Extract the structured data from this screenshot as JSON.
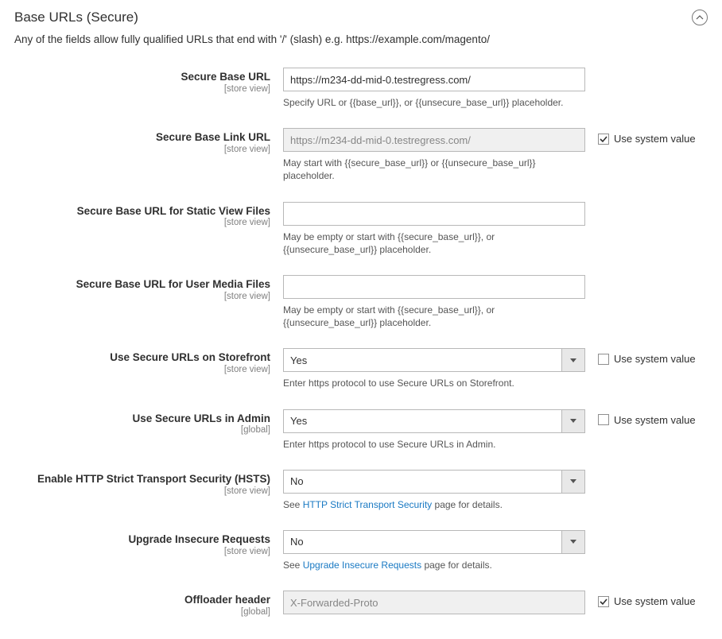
{
  "section": {
    "title": "Base URLs (Secure)",
    "subtext": "Any of the fields allow fully qualified URLs that end with '/' (slash) e.g. https://example.com/magento/"
  },
  "use_system_label": "Use system value",
  "fields": {
    "secure_base_url": {
      "label": "Secure Base URL",
      "scope": "[store view]",
      "value": "https://m234-dd-mid-0.testregress.com/",
      "helper": "Specify URL or {{base_url}}, or {{unsecure_base_url}} placeholder."
    },
    "secure_base_link_url": {
      "label": "Secure Base Link URL",
      "scope": "[store view]",
      "value": "https://m234-dd-mid-0.testregress.com/",
      "helper": "May start with {{secure_base_url}} or {{unsecure_base_url}} placeholder."
    },
    "secure_static": {
      "label": "Secure Base URL for Static View Files",
      "scope": "[store view]",
      "value": "",
      "helper": "May be empty or start with {{secure_base_url}}, or {{unsecure_base_url}} placeholder."
    },
    "secure_media": {
      "label": "Secure Base URL for User Media Files",
      "scope": "[store view]",
      "value": "",
      "helper": "May be empty or start with {{secure_base_url}}, or {{unsecure_base_url}} placeholder."
    },
    "use_secure_storefront": {
      "label": "Use Secure URLs on Storefront",
      "scope": "[store view]",
      "value": "Yes",
      "helper": "Enter https protocol to use Secure URLs on Storefront."
    },
    "use_secure_admin": {
      "label": "Use Secure URLs in Admin",
      "scope": "[global]",
      "value": "Yes",
      "helper": "Enter https protocol to use Secure URLs in Admin."
    },
    "hsts": {
      "label": "Enable HTTP Strict Transport Security (HSTS)",
      "scope": "[store view]",
      "value": "No",
      "helper_prefix": "See ",
      "helper_link": "HTTP Strict Transport Security",
      "helper_suffix": " page for details."
    },
    "upgrade_insecure": {
      "label": "Upgrade Insecure Requests",
      "scope": "[store view]",
      "value": "No",
      "helper_prefix": "See ",
      "helper_link": "Upgrade Insecure Requests",
      "helper_suffix": " page for details."
    },
    "offloader": {
      "label": "Offloader header",
      "scope": "[global]",
      "value": "X-Forwarded-Proto"
    }
  }
}
